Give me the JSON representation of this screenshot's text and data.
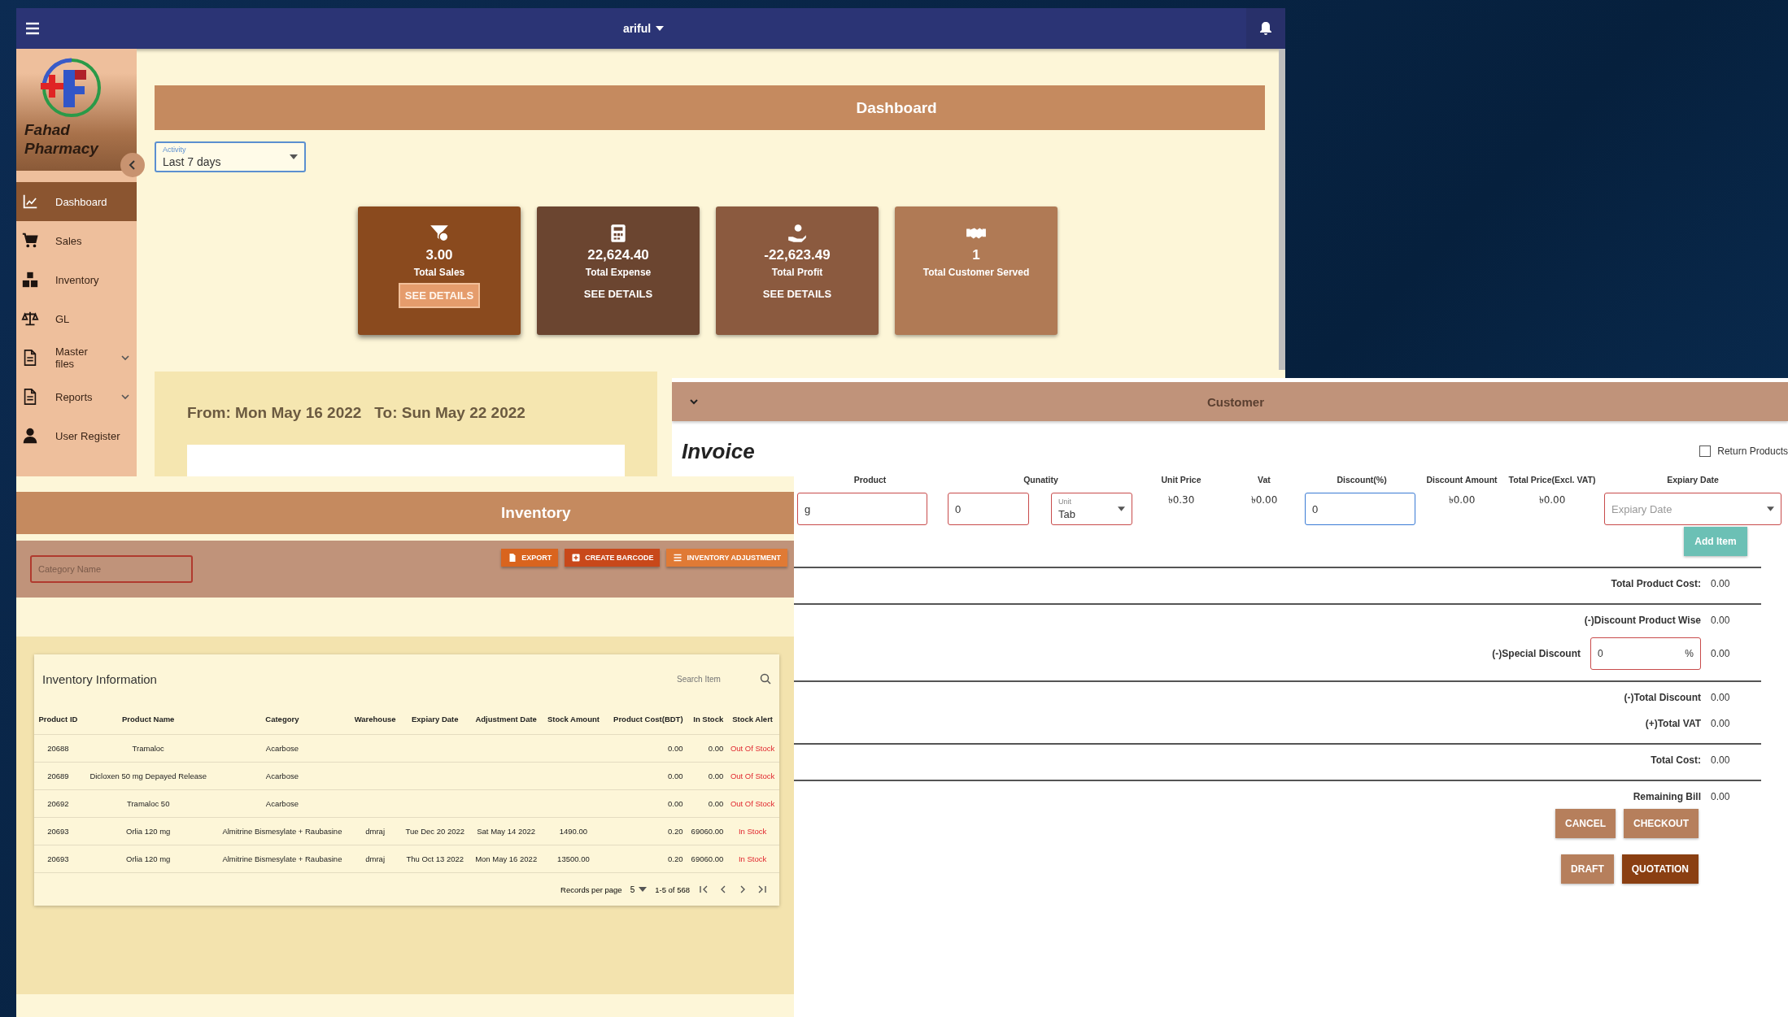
{
  "top_bar": {
    "user": "ariful"
  },
  "sidebar": {
    "brand": "Fahad Pharmacy",
    "items": [
      {
        "label": "Dashboard",
        "kind": "chart",
        "selected": true,
        "expandable": false
      },
      {
        "label": "Sales",
        "kind": "cart",
        "selected": false,
        "expandable": false
      },
      {
        "label": "Inventory",
        "kind": "boxes",
        "selected": false,
        "expandable": false
      },
      {
        "label": "GL",
        "kind": "scale",
        "selected": false,
        "expandable": false
      },
      {
        "label": "Master files",
        "kind": "file",
        "selected": false,
        "expandable": true
      },
      {
        "label": "Reports",
        "kind": "file",
        "selected": false,
        "expandable": true
      },
      {
        "label": "User Register",
        "kind": "user",
        "selected": false,
        "expandable": false
      }
    ]
  },
  "dashboard": {
    "title": "Dashboard",
    "activity": {
      "label": "Activity",
      "value": "Last 7 days"
    },
    "cards": [
      {
        "kind": "sales",
        "value": "3.00",
        "label": "Total Sales",
        "action": "SEE DETAILS",
        "highlighted": true
      },
      {
        "kind": "expense",
        "value": "22,624.40",
        "label": "Total Expense",
        "action": "SEE DETAILS",
        "highlighted": false
      },
      {
        "kind": "profit",
        "value": "-22,623.49",
        "label": "Total Profit",
        "action": "SEE DETAILS",
        "highlighted": false
      },
      {
        "kind": "customers",
        "value": "1",
        "label": "Total Customer Served"
      }
    ],
    "date_range": {
      "from": "From: Mon May 16 2022",
      "to": "To: Sun May 22 2022"
    }
  },
  "inventory": {
    "title": "Inventory",
    "category_placeholder": "Category Name",
    "buttons": [
      {
        "kind": "export",
        "label": "EXPORT"
      },
      {
        "kind": "barcode",
        "label": "CREATE BARCODE"
      },
      {
        "kind": "adjust",
        "label": "INVENTORY ADJUSTMENT"
      }
    ],
    "table_title": "Inventory Information",
    "search_placeholder": "Search Item",
    "columns": [
      "Product ID",
      "Product Name",
      "Category",
      "Warehouse",
      "Expiary Date",
      "Adjustment Date",
      "Stock Amount",
      "Product Cost(BDT)",
      "In Stock",
      "Stock Alert"
    ],
    "rows": [
      [
        "20688",
        "Tramaloc",
        "Acarbose",
        "",
        "",
        "",
        "",
        "0.00",
        "0.00",
        "Out Of Stock"
      ],
      [
        "20689",
        "Dicloxen 50 mg Depayed Release",
        "Acarbose",
        "",
        "",
        "",
        "",
        "0.00",
        "0.00",
        "Out Of Stock"
      ],
      [
        "20692",
        "Tramaloc 50",
        "Acarbose",
        "",
        "",
        "",
        "",
        "0.00",
        "0.00",
        "Out Of Stock"
      ],
      [
        "20693",
        "Orlia 120 mg",
        "Almitrine Bismesylate + Raubasine",
        "dmraj",
        "Tue Dec 20 2022",
        "Sat May 14 2022",
        "1490.00",
        "0.20",
        "69060.00",
        "In Stock"
      ],
      [
        "20693",
        "Orlia 120 mg",
        "Almitrine Bismesylate + Raubasine",
        "dmraj",
        "Thu Oct 13 2022",
        "Mon May 16 2022",
        "13500.00",
        "0.20",
        "69060.00",
        "In Stock"
      ]
    ],
    "pagination": {
      "label": "Records per page",
      "per_page": "5",
      "range": "1-5 of 568"
    }
  },
  "invoice": {
    "customer_bar": "Customer",
    "title": "Invoice",
    "return_products": {
      "label": "Return Products",
      "checked": false
    },
    "columns": {
      "product": "Product",
      "quantity": "Qunatity",
      "unit_price": "Unit Price",
      "vat": "Vat",
      "discount": "Discount(%)",
      "discount_amount": "Discount Amount",
      "total_price": "Total Price(Excl. VAT)",
      "expiry": "Expiary Date"
    },
    "item": {
      "product": "g",
      "quantity": "0",
      "unit_label": "Unit",
      "unit": "Tab",
      "unit_price": "৳0.30",
      "vat": "৳0.00",
      "discount": {
        "value": "0",
        "focused": true
      },
      "discount_amount": "৳0.00",
      "total_price": "৳0.00",
      "expiry_placeholder": "Expiary Date"
    },
    "add_item": "Add Item",
    "sections": [
      {
        "rows": [
          {
            "kind": "text",
            "label": "Total Product Cost:",
            "value": "0.00"
          }
        ]
      },
      {
        "rows": [
          {
            "kind": "text",
            "label": "(-)Discount Product Wise",
            "value": "0.00"
          },
          {
            "kind": "field",
            "label": "(-)Special Discount",
            "input": "0",
            "unit": "%",
            "value": "0.00"
          }
        ]
      },
      {
        "rows": [
          {
            "kind": "text",
            "label": "(-)Total Discount",
            "value": "0.00"
          },
          {
            "kind": "text",
            "label": "(+)Total VAT",
            "value": "0.00"
          }
        ]
      },
      {
        "rows": [
          {
            "kind": "text",
            "label": "Total Cost:",
            "value": "0.00"
          }
        ]
      },
      {
        "rows": [
          {
            "kind": "text",
            "label": "Remaining Bill",
            "value": "0.00"
          }
        ]
      }
    ],
    "actions": [
      {
        "buttons": [
          {
            "label": "CANCEL",
            "primary": false
          },
          {
            "label": "CHECKOUT",
            "primary": false
          }
        ]
      },
      {
        "buttons": [
          {
            "label": "DRAFT",
            "primary": false
          },
          {
            "label": "QUOTATION",
            "primary": true
          }
        ]
      }
    ]
  }
}
